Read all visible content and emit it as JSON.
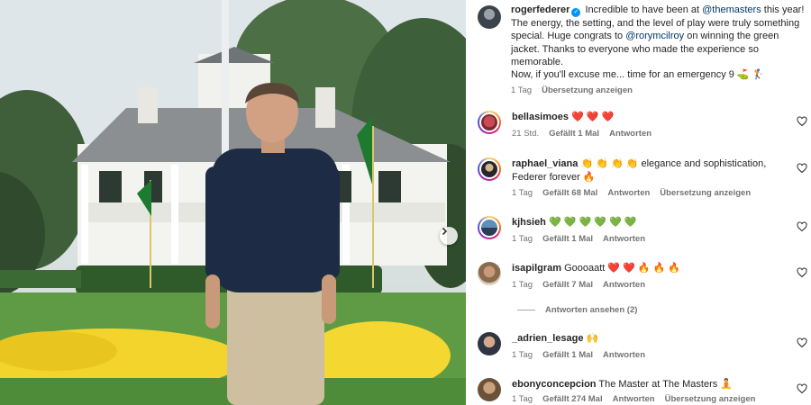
{
  "post": {
    "username": "rogerfederer",
    "caption_part1": "Incredible to have been at ",
    "mention1": "@themasters",
    "caption_part2": " this year! The energy, the setting, and the level of play were truly something special. Huge congrats to ",
    "mention2": "@rorymcilroy",
    "caption_part3": " on winning the green jacket. Thanks to everyone who made the experience so memorable.",
    "caption_part4": "Now, if you'll excuse me... time for an emergency 9 ⛳ 🏌",
    "time": "1 Tag",
    "translate": "Übersetzung anzeigen"
  },
  "comments": [
    {
      "username": "bellasimoes",
      "text": "❤️ ❤️ ❤️",
      "time": "21 Std.",
      "likes": "Gefällt 1 Mal",
      "reply": "Antworten",
      "translate": ""
    },
    {
      "username": "raphael_viana",
      "text": "👏 👏 👏 👏 elegance and sophistication, Federer forever 🔥",
      "time": "1 Tag",
      "likes": "Gefällt 68 Mal",
      "reply": "Antworten",
      "translate": "Übersetzung anzeigen"
    },
    {
      "username": "kjhsieh",
      "text": "💚 💚 💚 💚 💚 💚",
      "time": "1 Tag",
      "likes": "Gefällt 1 Mal",
      "reply": "Antworten",
      "translate": ""
    },
    {
      "username": "isapilgram",
      "text": "Goooaatt ❤️ ❤️ 🔥 🔥 🔥",
      "time": "1 Tag",
      "likes": "Gefällt 7 Mal",
      "reply": "Antworten",
      "translate": ""
    },
    {
      "username": "_adrien_lesage",
      "text": "🙌",
      "time": "1 Tag",
      "likes": "Gefällt 1 Mal",
      "reply": "Antworten",
      "translate": ""
    },
    {
      "username": "ebonyconcepcion",
      "text": "The Master at The Masters 🧘",
      "time": "1 Tag",
      "likes": "Gefällt 274 Mal",
      "reply": "Antworten",
      "translate": "Übersetzung anzeigen"
    }
  ],
  "view_replies": "Antworten ansehen (2)",
  "colors": {
    "link": "#00376b",
    "meta": "#737373",
    "verified": "#0095f6",
    "heart": "#262626"
  },
  "icons": {
    "verified": "verified-badge-icon",
    "heart": "heart-outline-icon",
    "next": "chevron-right-icon"
  }
}
